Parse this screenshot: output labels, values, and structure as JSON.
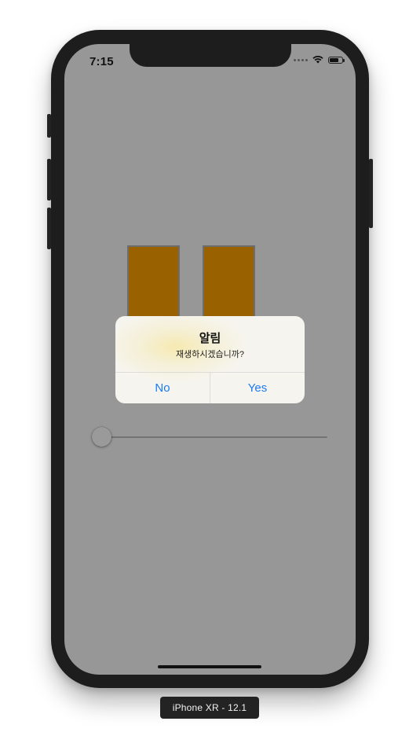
{
  "status_bar": {
    "time": "7:15",
    "icons": [
      "cellular-dots-icon",
      "wifi-icon",
      "battery-icon"
    ]
  },
  "player": {
    "control_icon": "pause-icon",
    "bar_color": "#9a6100",
    "slider_value": 0
  },
  "alert": {
    "title": "알림",
    "message": "재생하시겠습니까?",
    "buttons": [
      {
        "label": "No"
      },
      {
        "label": "Yes"
      }
    ],
    "button_color": "#1a7cf5"
  },
  "device_label": "iPhone XR - 12.1"
}
